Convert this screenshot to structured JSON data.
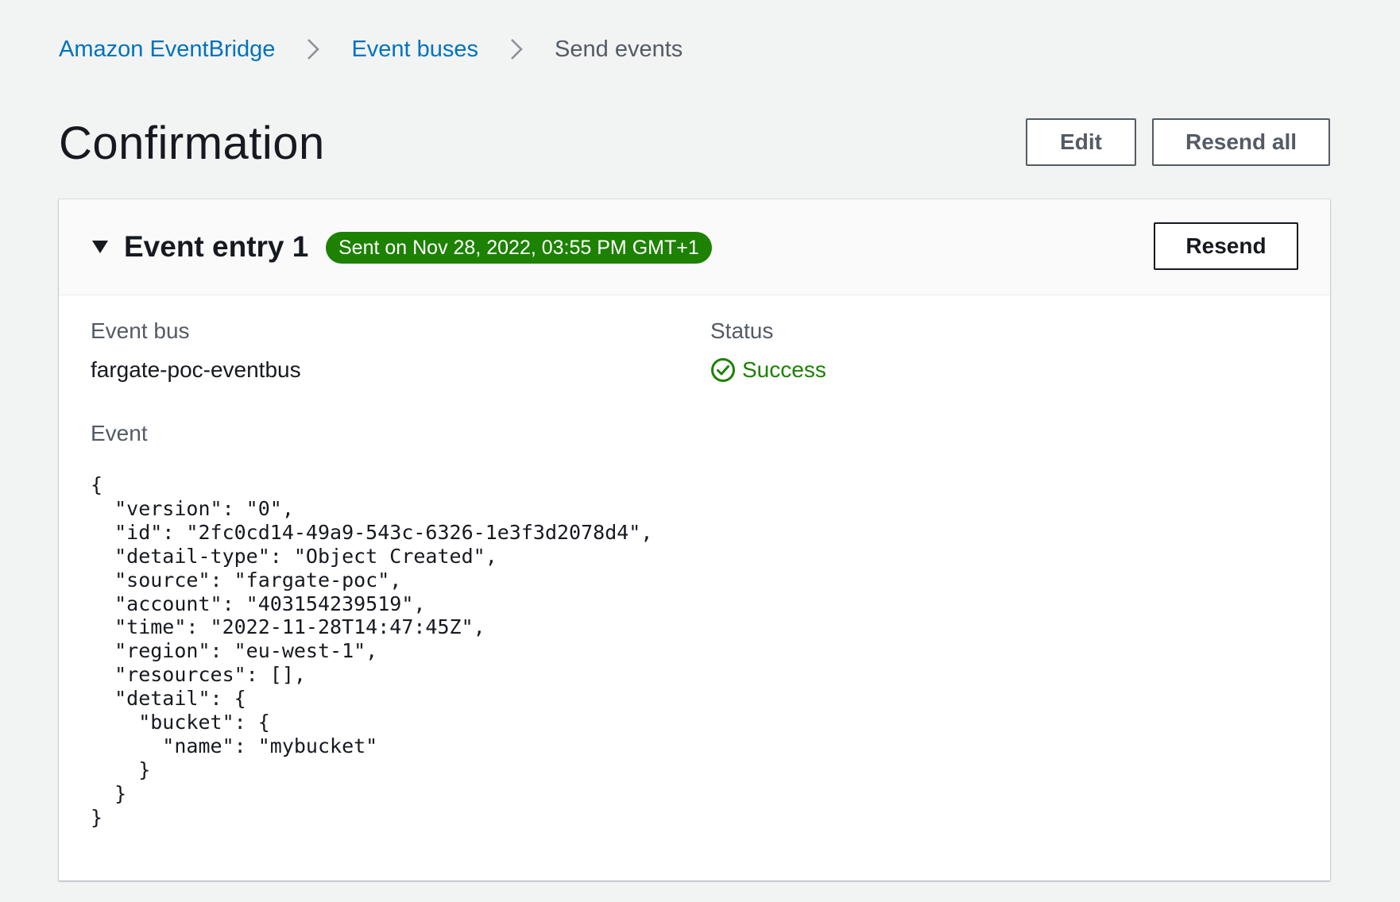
{
  "breadcrumb": {
    "items": [
      {
        "label": "Amazon EventBridge"
      },
      {
        "label": "Event buses"
      },
      {
        "label": "Send events"
      }
    ]
  },
  "header": {
    "title": "Confirmation",
    "edit_label": "Edit",
    "resend_all_label": "Resend all"
  },
  "entry": {
    "title": "Event entry 1",
    "sent_badge": "Sent on Nov 28, 2022, 03:55 PM GMT+1",
    "resend_label": "Resend",
    "event_bus_label": "Event bus",
    "event_bus_value": "fargate-poc-eventbus",
    "status_label": "Status",
    "status_value": "Success",
    "event_label": "Event",
    "event_json": "{\n  \"version\": \"0\",\n  \"id\": \"2fc0cd14-49a9-543c-6326-1e3f3d2078d4\",\n  \"detail-type\": \"Object Created\",\n  \"source\": \"fargate-poc\",\n  \"account\": \"403154239519\",\n  \"time\": \"2022-11-28T14:47:45Z\",\n  \"region\": \"eu-west-1\",\n  \"resources\": [],\n  \"detail\": {\n    \"bucket\": {\n      \"name\": \"mybucket\"\n    }\n  }\n}"
  },
  "icons": {
    "breadcrumb_separator": "chevron-right-icon",
    "expand": "caret-down-icon",
    "status": "check-circle-icon"
  },
  "colors": {
    "link": "#0073bb",
    "success": "#1d8102",
    "background": "#f2f3f3"
  }
}
